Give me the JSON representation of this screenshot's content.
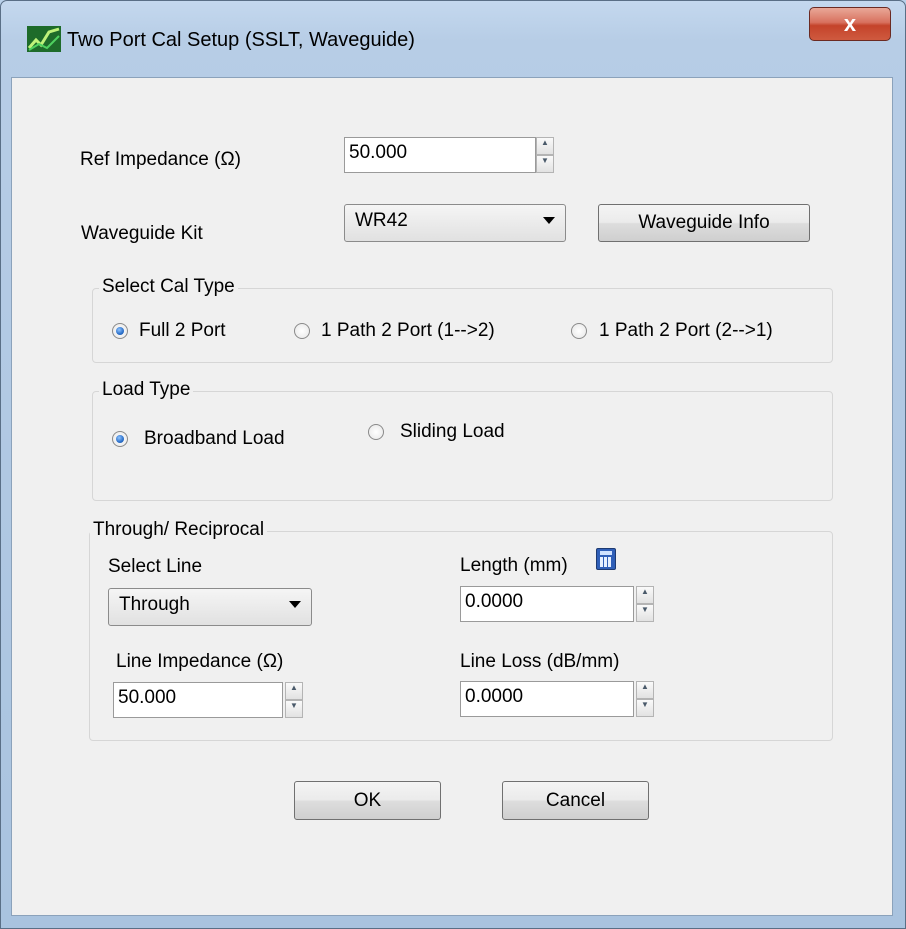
{
  "window": {
    "title": "Two Port Cal Setup (SSLT, Waveguide)",
    "close_glyph": "x"
  },
  "ref_impedance": {
    "label": "Ref Impedance (Ω)",
    "value": "50.000"
  },
  "waveguide": {
    "label": "Waveguide  Kit",
    "selected": "WR42",
    "info_button": "Waveguide Info"
  },
  "cal_type": {
    "legend": "Select Cal Type",
    "options": [
      "Full 2 Port",
      "1 Path 2 Port (1-->2)",
      "1 Path 2 Port (2-->1)"
    ],
    "selected_index": 0
  },
  "load_type": {
    "legend": "Load Type",
    "options": [
      "Broadband Load",
      "Sliding Load"
    ],
    "selected_index": 0
  },
  "through": {
    "legend": "Through/ Reciprocal",
    "select_line_label": "Select Line",
    "select_line_value": "Through",
    "length_label": "Length (mm)",
    "length_value": "0.0000",
    "line_impedance_label": "Line Impedance (Ω)",
    "line_impedance_value": "50.000",
    "line_loss_label": "Line Loss (dB/mm)",
    "line_loss_value": "0.0000"
  },
  "buttons": {
    "ok": "OK",
    "cancel": "Cancel"
  },
  "icons": {
    "app": "app-logo-icon",
    "calculator": "calculator-icon"
  }
}
